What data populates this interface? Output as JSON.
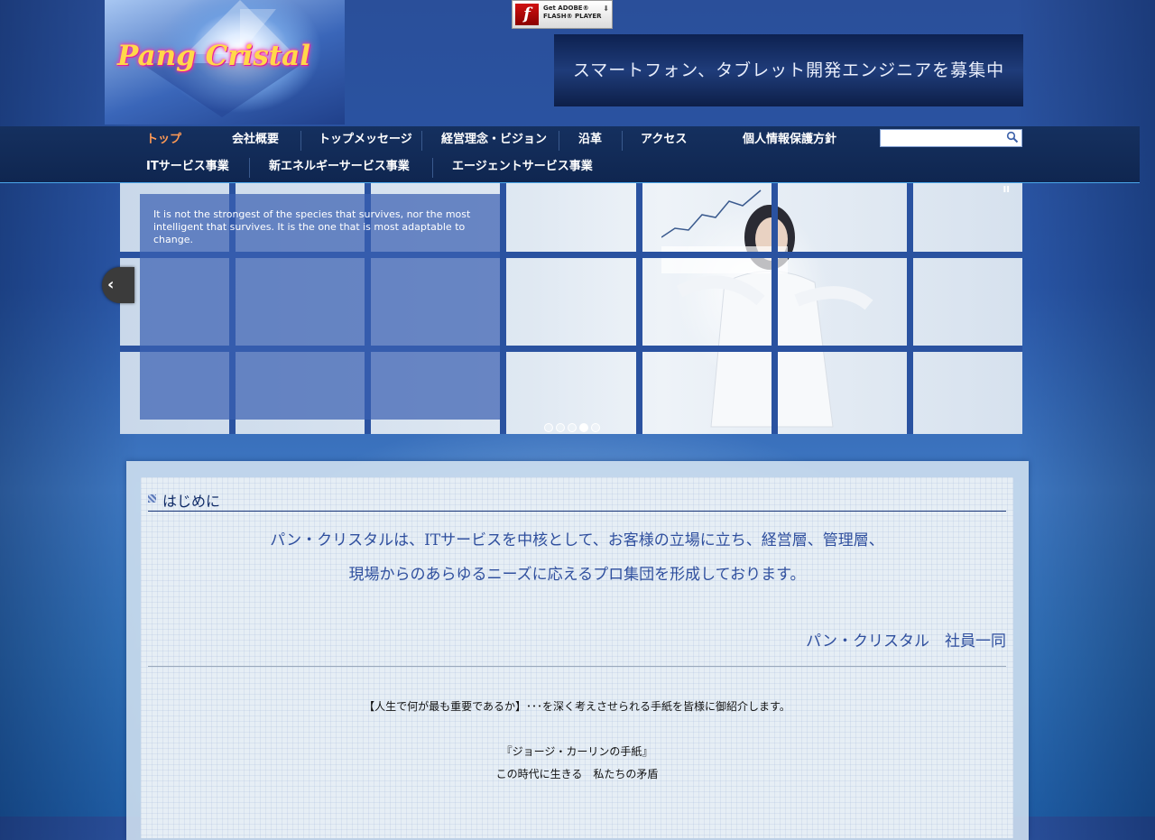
{
  "header": {
    "logo_text": "Pang Cristal",
    "flash_badge": {
      "icon_glyph": "f",
      "line1": "Get ADOBE®",
      "line2": "FLASH® PLAYER"
    },
    "recruit_banner": "スマートフォン、タブレット開発エンジニアを募集中"
  },
  "nav": {
    "row1": [
      {
        "label": "トップ",
        "active": true
      },
      {
        "label": "会社概要",
        "active": false
      },
      {
        "label": "トップメッセージ",
        "active": false
      },
      {
        "label": "経営理念・ビジョン",
        "active": false
      },
      {
        "label": "沿革",
        "active": false
      },
      {
        "label": "アクセス",
        "active": false
      },
      {
        "label": "個人情報保護方針",
        "active": false
      }
    ],
    "row2": [
      {
        "label": "ITサービス事業"
      },
      {
        "label": "新エネルギーサービス事業"
      },
      {
        "label": "エージェントサービス事業"
      }
    ],
    "search": {
      "placeholder": "",
      "value": ""
    }
  },
  "slider": {
    "quote": "It is not the strongest of the species that survives, nor the most intelligent that survives. It is the one that is most adaptable to change.",
    "slide_count": 5,
    "active_slide": 4,
    "pause_glyph": "II",
    "prev_glyph": "‹"
  },
  "content": {
    "section_title": "はじめに",
    "intro_line1": "パン・クリスタルは、ITサービスを中核として、お客様の立場に立ち、経営層、管理層、",
    "intro_line2": "現場からのあらゆるニーズに応えるプロ集団を形成しております。",
    "signature": "パン・クリスタル　社員一同",
    "body_line1": "【人生で何が最も重要であるか】･･･を深く考えさせられる手紙を皆様に御紹介します。",
    "body_line2": "『ジョージ・カーリンの手紙』",
    "body_line3": "この時代に生きる　私たちの矛盾"
  },
  "colors": {
    "nav_active": "#ff9a55",
    "heading_blue": "#2f4f9e",
    "nav_bg": "#15305f"
  }
}
